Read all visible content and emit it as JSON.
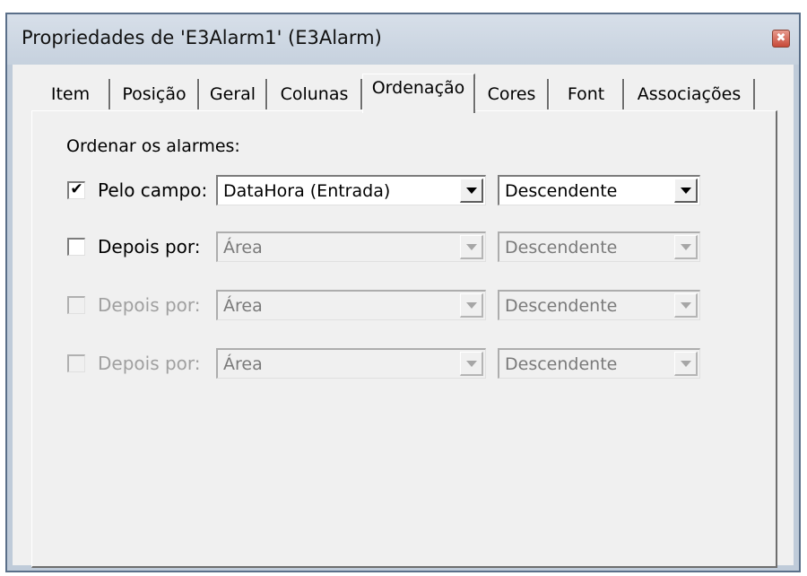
{
  "window": {
    "title": "Propriedades de 'E3Alarm1' (E3Alarm)",
    "close_glyph": "✖"
  },
  "tabs": [
    {
      "label": "Item",
      "active": false
    },
    {
      "label": "Posição",
      "active": false
    },
    {
      "label": "Geral",
      "active": false
    },
    {
      "label": "Colunas",
      "active": false
    },
    {
      "label": "Ordenação",
      "active": true
    },
    {
      "label": "Cores",
      "active": false
    },
    {
      "label": "Font",
      "active": false
    },
    {
      "label": "Associações",
      "active": false
    }
  ],
  "sort": {
    "group_label": "Ordenar os alarmes:",
    "rows": [
      {
        "label": "Pelo campo:",
        "checked": true,
        "check_glyph": "✔",
        "enabled": true,
        "field": "DataHora (Entrada)",
        "order": "Descendente"
      },
      {
        "label": "Depois por:",
        "checked": false,
        "check_glyph": "",
        "enabled": true,
        "field": "Área",
        "order": "Descendente"
      },
      {
        "label": "Depois por:",
        "checked": false,
        "check_glyph": "",
        "enabled": false,
        "field": "Área",
        "order": "Descendente"
      },
      {
        "label": "Depois por:",
        "checked": false,
        "check_glyph": "",
        "enabled": false,
        "field": "Área",
        "order": "Descendente"
      }
    ]
  }
}
